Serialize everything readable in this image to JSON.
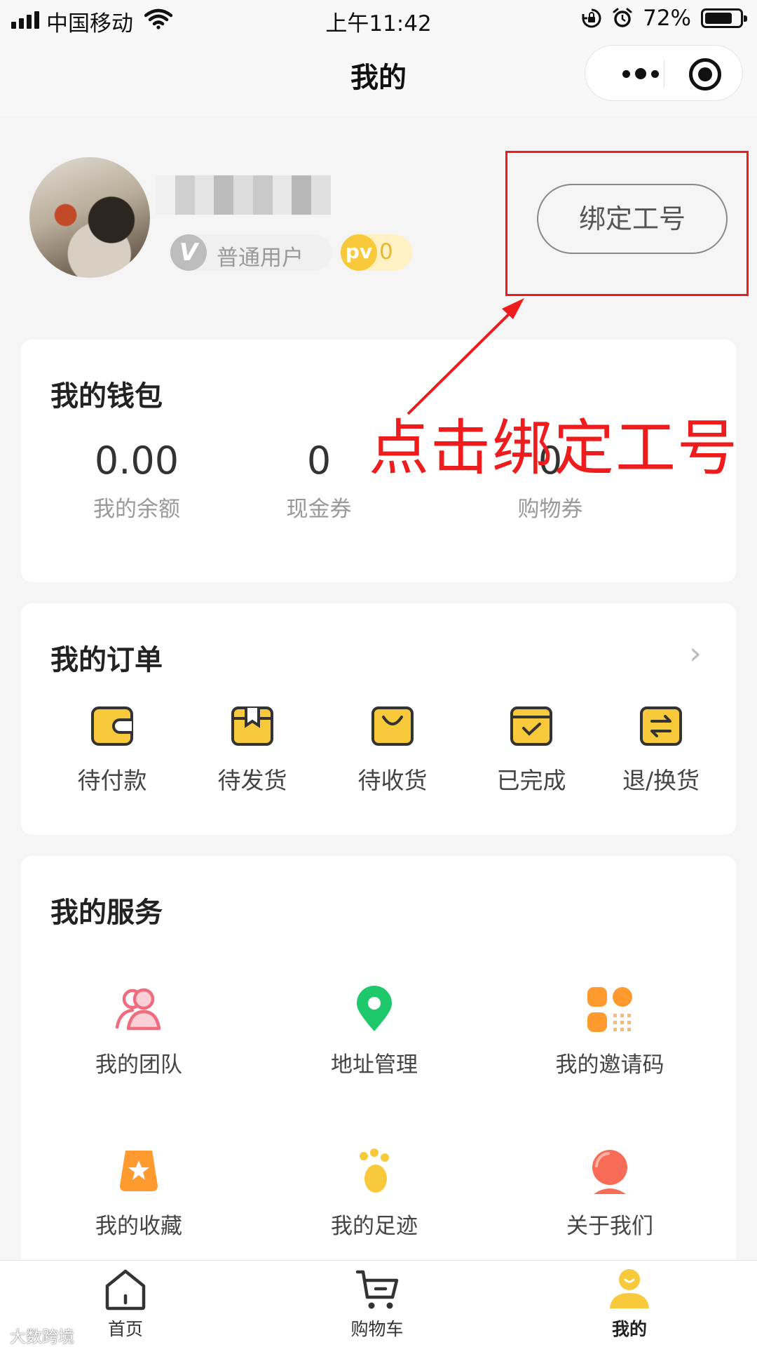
{
  "status_bar": {
    "carrier": "中国移动",
    "time": "上午11:42",
    "battery": "72%",
    "battery_level": 0.72
  },
  "nav": {
    "title": "我的"
  },
  "profile": {
    "user_level": "普通用户",
    "pv_label": "pv",
    "pv_value": "0",
    "bind_button": "绑定工号"
  },
  "annotation": {
    "text": "点击绑定工号",
    "color": "#ee1c1c"
  },
  "wallet": {
    "title": "我的钱包",
    "items": [
      {
        "value": "0.00",
        "label": "我的余额"
      },
      {
        "value": "0",
        "label": "现金券"
      },
      {
        "value": "0",
        "label": "购物券"
      }
    ]
  },
  "orders": {
    "title": "我的订单",
    "items": [
      {
        "label": "待付款",
        "icon": "wallet-icon"
      },
      {
        "label": "待发货",
        "icon": "package-icon"
      },
      {
        "label": "待收货",
        "icon": "shopping-bag-icon"
      },
      {
        "label": "已完成",
        "icon": "check-box-icon"
      },
      {
        "label": "退/换货",
        "icon": "exchange-icon"
      }
    ]
  },
  "services": {
    "title": "我的服务",
    "items": [
      {
        "label": "我的团队",
        "icon": "team-icon"
      },
      {
        "label": "地址管理",
        "icon": "location-pin-icon"
      },
      {
        "label": "我的邀请码",
        "icon": "qr-code-icon"
      },
      {
        "label": "我的收藏",
        "icon": "star-icon"
      },
      {
        "label": "我的足迹",
        "icon": "footprint-icon"
      },
      {
        "label": "关于我们",
        "icon": "info-icon"
      }
    ]
  },
  "tabbar": {
    "items": [
      {
        "label": "首页",
        "icon": "home-icon"
      },
      {
        "label": "购物车",
        "icon": "cart-icon"
      },
      {
        "label": "我的",
        "icon": "user-icon",
        "active": true
      }
    ]
  },
  "watermark": "大数跨境",
  "colors": {
    "accent": "#f8c93b",
    "annotation": "#ee1c1c",
    "location": "#1ec96b",
    "team": "#f06b7e",
    "orange": "#ff9a2e"
  }
}
